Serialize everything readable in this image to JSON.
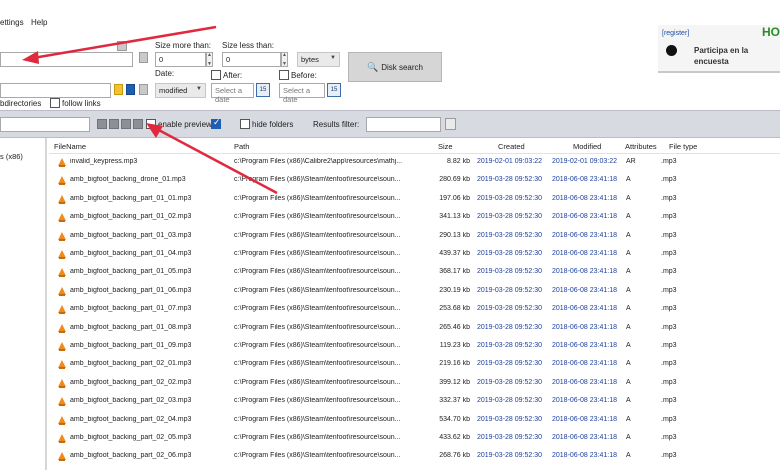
{
  "menu": {
    "settings": "ettings",
    "help": "Help"
  },
  "search": {
    "size_more_label": "Size more than:",
    "size_less_label": "Size less than:",
    "size_more_value": "0",
    "size_less_value": "0",
    "unit": "bytes",
    "date_label": "Date:",
    "date_mode": "modified",
    "after_label": "After:",
    "before_label": "Before:",
    "after_placeholder": "Select a date",
    "before_placeholder": "Select a date",
    "calendar_day": "15",
    "subdirs_label": "bdirectories",
    "follow_links_label": "follow links",
    "disk_search_label": "Disk search"
  },
  "ad": {
    "register": "[register]",
    "text": "Participa en la encuesta",
    "hot": "HO"
  },
  "toolbar": {
    "enable_preview_label": "enable preview",
    "hide_folders_label": "hide folders",
    "results_filter_label": "Results filter:"
  },
  "tree": {
    "node": "s (x86)"
  },
  "grid": {
    "columns": [
      "FileName",
      "Path",
      "Size",
      "Created",
      "Modified",
      "Attributes",
      "File type"
    ],
    "rows": [
      [
        "invalid_keypress.mp3",
        "c:\\Program Files (x86)\\Calibre2\\app\\resources\\mathj...",
        "8.82 kb",
        "2019-02-01 09:03:22",
        "2019-02-01 09:03:22",
        "AR",
        ".mp3"
      ],
      [
        "amb_bigfoot_backing_drone_01.mp3",
        "c:\\Program Files (x86)\\Steam\\tenfoot\\resource\\soun...",
        "280.69 kb",
        "2019-03-28 09:52:30",
        "2018-06-08 23:41:18",
        "A",
        ".mp3"
      ],
      [
        "amb_bigfoot_backing_part_01_01.mp3",
        "c:\\Program Files (x86)\\Steam\\tenfoot\\resource\\soun...",
        "197.06 kb",
        "2019-03-28 09:52:30",
        "2018-06-08 23:41:18",
        "A",
        ".mp3"
      ],
      [
        "amb_bigfoot_backing_part_01_02.mp3",
        "c:\\Program Files (x86)\\Steam\\tenfoot\\resource\\soun...",
        "341.13 kb",
        "2019-03-28 09:52:30",
        "2018-06-08 23:41:18",
        "A",
        ".mp3"
      ],
      [
        "amb_bigfoot_backing_part_01_03.mp3",
        "c:\\Program Files (x86)\\Steam\\tenfoot\\resource\\soun...",
        "290.13 kb",
        "2019-03-28 09:52:30",
        "2018-06-08 23:41:18",
        "A",
        ".mp3"
      ],
      [
        "amb_bigfoot_backing_part_01_04.mp3",
        "c:\\Program Files (x86)\\Steam\\tenfoot\\resource\\soun...",
        "439.37 kb",
        "2019-03-28 09:52:30",
        "2018-06-08 23:41:18",
        "A",
        ".mp3"
      ],
      [
        "amb_bigfoot_backing_part_01_05.mp3",
        "c:\\Program Files (x86)\\Steam\\tenfoot\\resource\\soun...",
        "368.17 kb",
        "2019-03-28 09:52:30",
        "2018-06-08 23:41:18",
        "A",
        ".mp3"
      ],
      [
        "amb_bigfoot_backing_part_01_06.mp3",
        "c:\\Program Files (x86)\\Steam\\tenfoot\\resource\\soun...",
        "230.19 kb",
        "2019-03-28 09:52:30",
        "2018-06-08 23:41:18",
        "A",
        ".mp3"
      ],
      [
        "amb_bigfoot_backing_part_01_07.mp3",
        "c:\\Program Files (x86)\\Steam\\tenfoot\\resource\\soun...",
        "253.68 kb",
        "2019-03-28 09:52:30",
        "2018-06-08 23:41:18",
        "A",
        ".mp3"
      ],
      [
        "amb_bigfoot_backing_part_01_08.mp3",
        "c:\\Program Files (x86)\\Steam\\tenfoot\\resource\\soun...",
        "265.46 kb",
        "2019-03-28 09:52:30",
        "2018-06-08 23:41:18",
        "A",
        ".mp3"
      ],
      [
        "amb_bigfoot_backing_part_01_09.mp3",
        "c:\\Program Files (x86)\\Steam\\tenfoot\\resource\\soun...",
        "119.23 kb",
        "2019-03-28 09:52:30",
        "2018-06-08 23:41:18",
        "A",
        ".mp3"
      ],
      [
        "amb_bigfoot_backing_part_02_01.mp3",
        "c:\\Program Files (x86)\\Steam\\tenfoot\\resource\\soun...",
        "219.16 kb",
        "2019-03-28 09:52:30",
        "2018-06-08 23:41:18",
        "A",
        ".mp3"
      ],
      [
        "amb_bigfoot_backing_part_02_02.mp3",
        "c:\\Program Files (x86)\\Steam\\tenfoot\\resource\\soun...",
        "399.12 kb",
        "2019-03-28 09:52:30",
        "2018-06-08 23:41:18",
        "A",
        ".mp3"
      ],
      [
        "amb_bigfoot_backing_part_02_03.mp3",
        "c:\\Program Files (x86)\\Steam\\tenfoot\\resource\\soun...",
        "332.37 kb",
        "2019-03-28 09:52:30",
        "2018-06-08 23:41:18",
        "A",
        ".mp3"
      ],
      [
        "amb_bigfoot_backing_part_02_04.mp3",
        "c:\\Program Files (x86)\\Steam\\tenfoot\\resource\\soun...",
        "534.70 kb",
        "2019-03-28 09:52:30",
        "2018-06-08 23:41:18",
        "A",
        ".mp3"
      ],
      [
        "amb_bigfoot_backing_part_02_05.mp3",
        "c:\\Program Files (x86)\\Steam\\tenfoot\\resource\\soun...",
        "433.62 kb",
        "2019-03-28 09:52:30",
        "2018-06-08 23:41:18",
        "A",
        ".mp3"
      ],
      [
        "amb_bigfoot_backing_part_02_06.mp3",
        "c:\\Program Files (x86)\\Steam\\tenfoot\\resource\\soun...",
        "268.76 kb",
        "2019-03-28 09:52:30",
        "2018-06-08 23:41:18",
        "A",
        ".mp3"
      ]
    ]
  },
  "colors": {
    "accent_blue": "#1b3fa0",
    "arrow_red": "#e0283e",
    "file_icon": "#f08a1c"
  },
  "icons": {
    "file_icon": "vlc-cone-icon",
    "calendar_icon": "calendar-icon",
    "disk_search_icon": "search-icon"
  }
}
